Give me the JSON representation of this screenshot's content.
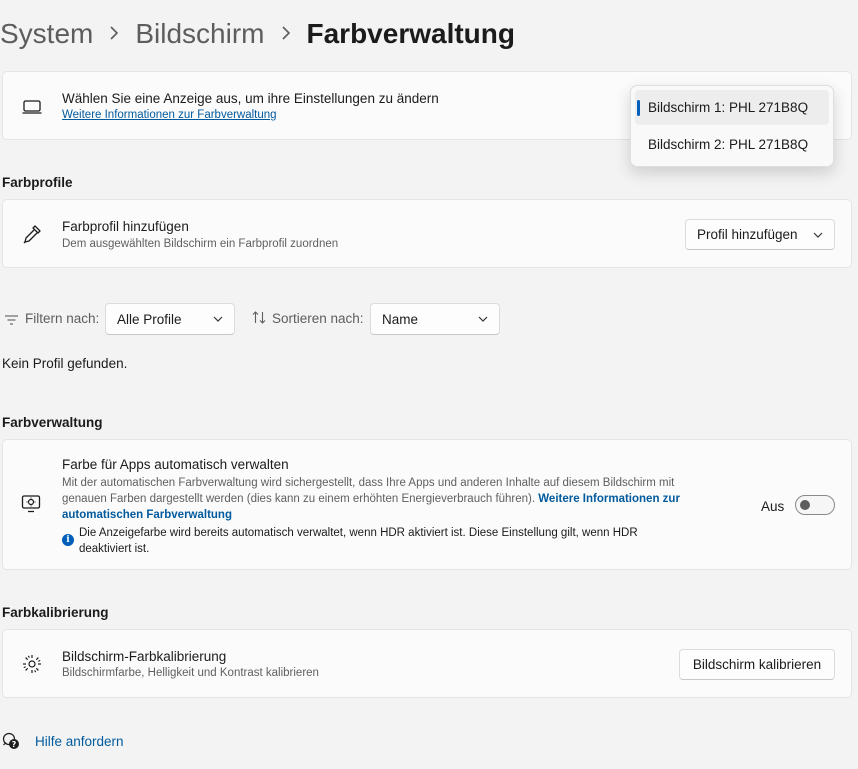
{
  "breadcrumb": {
    "items": [
      "System",
      "Bildschirm"
    ],
    "current": "Farbverwaltung"
  },
  "display_select": {
    "title": "Wählen Sie eine Anzeige aus, um ihre Einstellungen zu ändern",
    "link": "Weitere Informationen zur Farbverwaltung",
    "options": [
      "Bildschirm 1: PHL 271B8Q",
      "Bildschirm 2: PHL 271B8Q"
    ],
    "selected_index": 0
  },
  "farbprofile": {
    "heading": "Farbprofile",
    "add_card": {
      "title": "Farbprofil hinzufügen",
      "subtitle": "Dem ausgewählten Bildschirm ein Farbprofil zuordnen",
      "button": "Profil hinzufügen"
    },
    "filter": {
      "label": "Filtern nach:",
      "value": "Alle Profile"
    },
    "sort": {
      "label": "Sortieren nach:",
      "value": "Name"
    },
    "empty_text": "Kein Profil gefunden."
  },
  "farbverwaltung": {
    "heading": "Farbverwaltung",
    "title": "Farbe für Apps automatisch verwalten",
    "desc": "Mit der automatischen Farbverwaltung wird sichergestellt, dass Ihre Apps und anderen Inhalte auf diesem Bildschirm mit genauen Farben dargestellt werden (dies kann zu einem erhöhten Energieverbrauch führen).",
    "desc_link": "Weitere Informationen zur automatischen Farbverwaltung",
    "info": "Die Anzeigefarbe wird bereits automatisch verwaltet, wenn HDR aktiviert ist. Diese Einstellung gilt, wenn HDR deaktiviert ist.",
    "toggle_label": "Aus",
    "toggle_on": false
  },
  "farbkalibrierung": {
    "heading": "Farbkalibrierung",
    "title": "Bildschirm-Farbkalibrierung",
    "subtitle": "Bildschirmfarbe, Helligkeit und Kontrast kalibrieren",
    "button": "Bildschirm kalibrieren"
  },
  "help": {
    "label": "Hilfe anfordern"
  },
  "icons": [
    "monitor-icon",
    "eyedropper-icon",
    "filter-icon",
    "sort-icon",
    "color-management-icon",
    "info-icon",
    "calibration-icon",
    "help-icon",
    "chevron-down-icon",
    "chevron-right-icon"
  ],
  "colors": {
    "accent": "#005fb8",
    "link": "#005a9e",
    "background": "#f3f3f3",
    "card": "#fbfbfb"
  }
}
